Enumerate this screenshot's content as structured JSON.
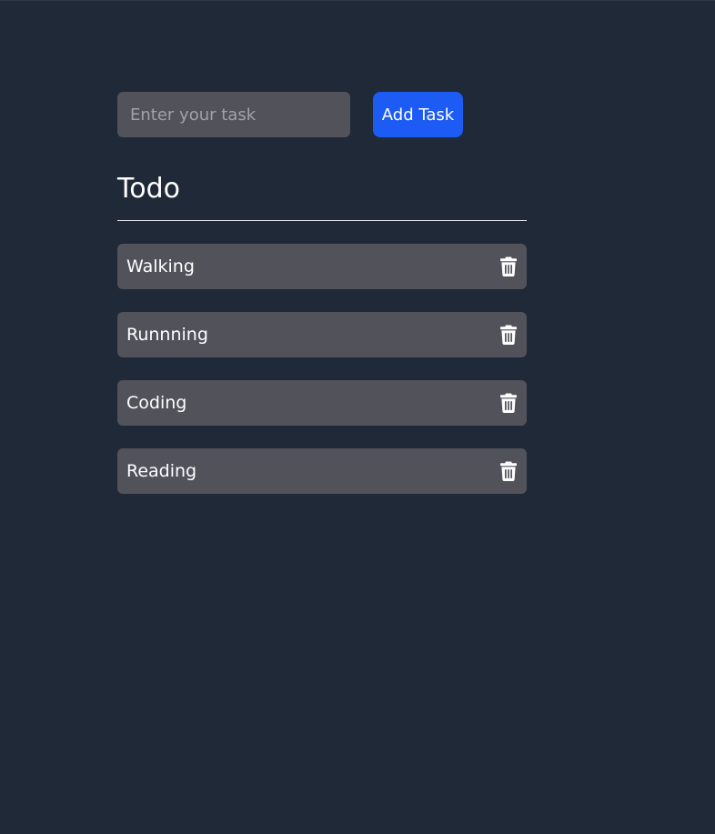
{
  "input": {
    "placeholder": "Enter your task",
    "value": ""
  },
  "add_button": {
    "label": "Add Task"
  },
  "section": {
    "title": "Todo"
  },
  "tasks": [
    {
      "label": "Walking",
      "icon": "trash-icon"
    },
    {
      "label": "Runnning",
      "icon": "trash-icon"
    },
    {
      "label": "Coding",
      "icon": "trash-icon"
    },
    {
      "label": "Reading",
      "icon": "trash-icon"
    }
  ],
  "colors": {
    "background": "#1f2937",
    "surface": "#52525b",
    "accent": "#1d5bf5",
    "text": "#ffffff",
    "placeholder": "#a1a1aa"
  }
}
